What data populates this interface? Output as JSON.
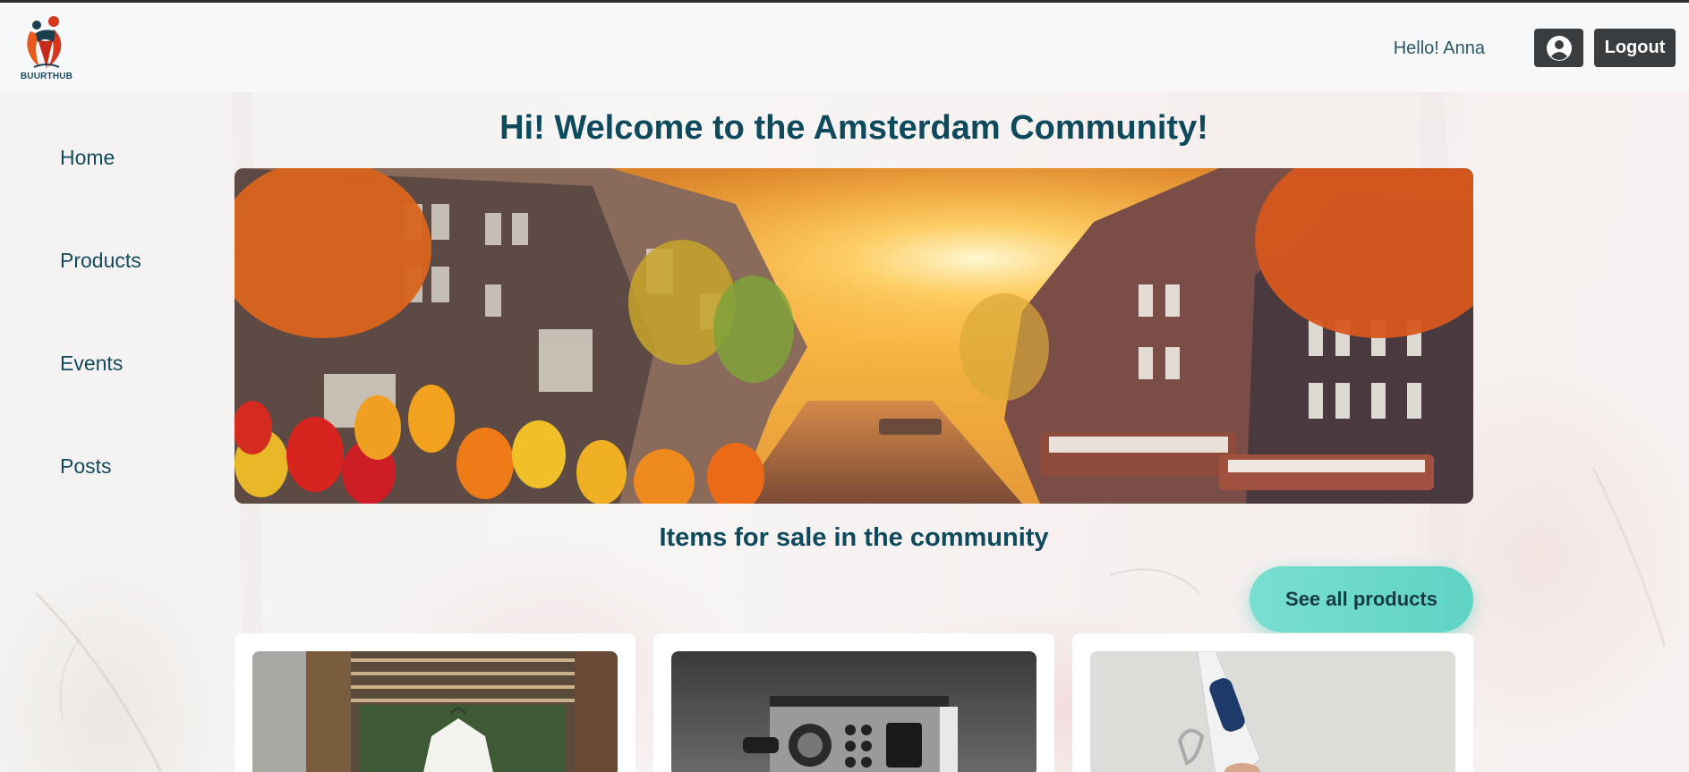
{
  "header": {
    "logo_text": "BUURTHUB",
    "greeting": "Hello! Anna",
    "profile_icon": "user-circle-icon",
    "logout_label": "Logout"
  },
  "sidebar": {
    "items": [
      {
        "label": "Home"
      },
      {
        "label": "Products"
      },
      {
        "label": "Events"
      },
      {
        "label": "Posts"
      }
    ]
  },
  "main": {
    "welcome_title": "Hi! Welcome to the Amsterdam Community!",
    "hero_image": "amsterdam-canal-sunset-tulips",
    "items_title": "Items for sale in the community",
    "see_all_label": "See all products",
    "products": [
      {
        "image": "white-dress-on-porch"
      },
      {
        "image": "espresso-machine"
      },
      {
        "image": "hand-blender"
      }
    ]
  },
  "colors": {
    "primary_text": "#0f4a5c",
    "button_dark": "#3a3d40",
    "accent_teal": "#5fd3c4"
  }
}
